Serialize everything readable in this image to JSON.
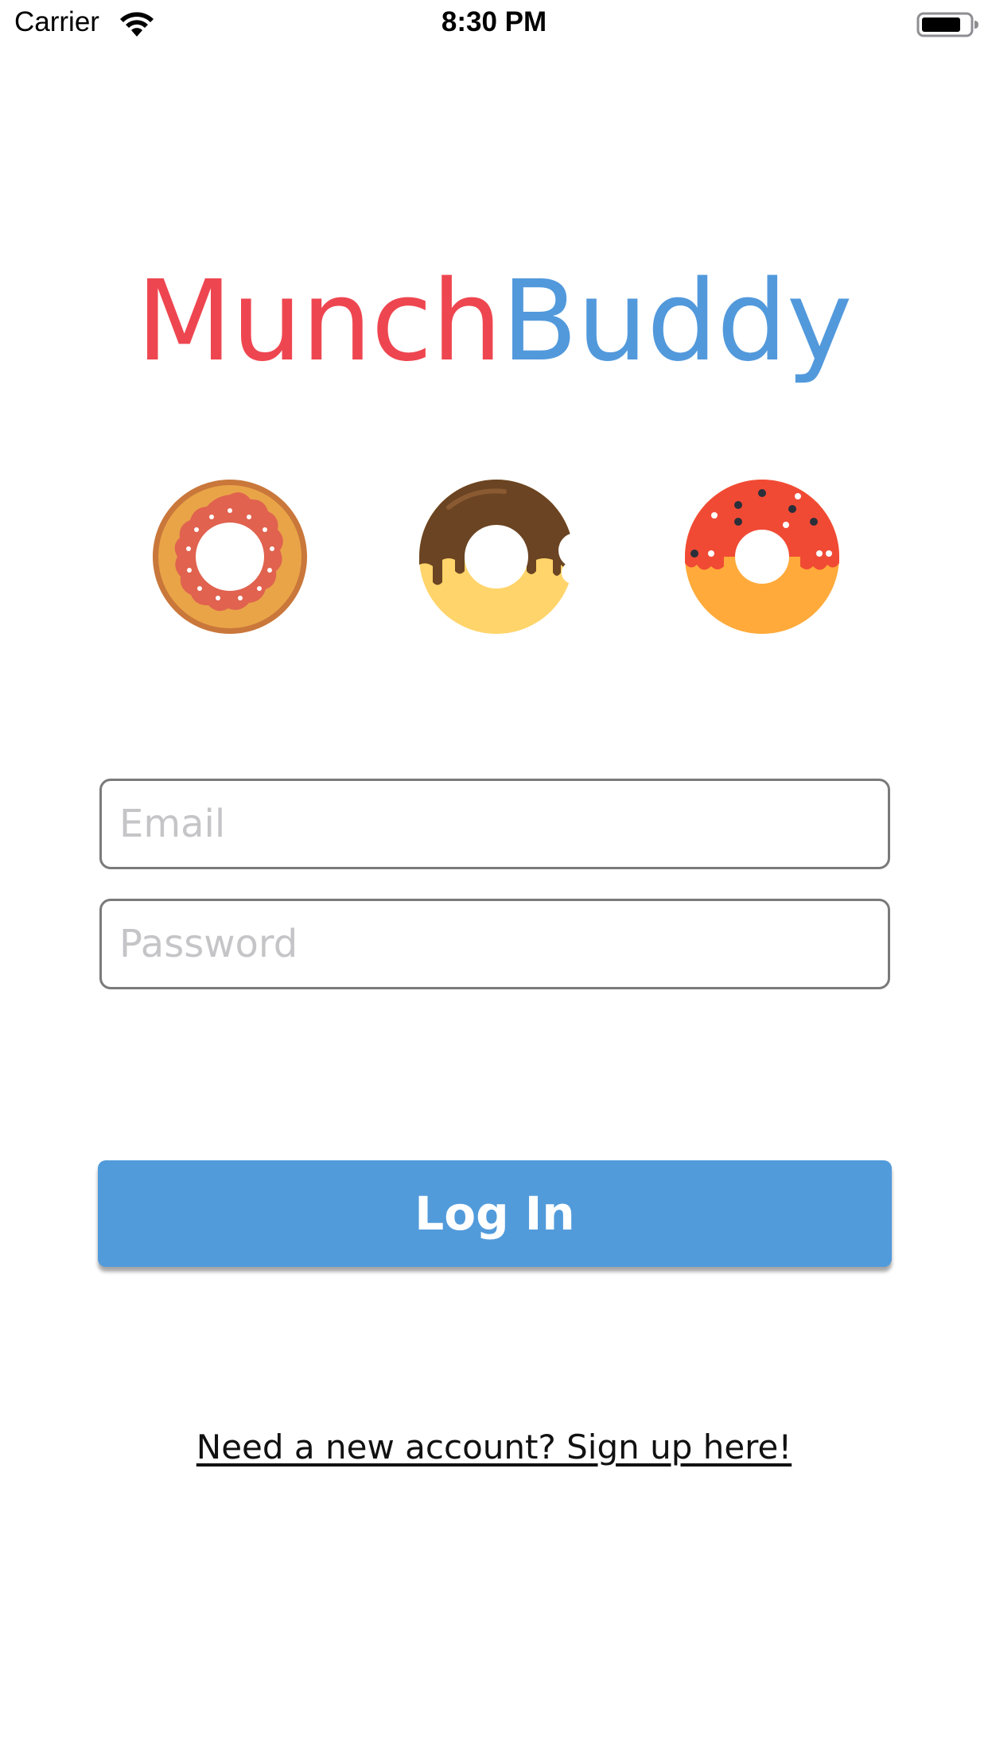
{
  "status_bar": {
    "carrier": "Carrier",
    "time": "8:30 PM",
    "wifi_icon": "wifi-icon",
    "battery_icon": "battery-icon"
  },
  "brand": {
    "part1": "Munch",
    "part2": "Buddy",
    "part1_color": "#ee4650",
    "part2_color": "#5299dc"
  },
  "donuts": [
    {
      "icon": "pink-frosted-donut-icon"
    },
    {
      "icon": "chocolate-bitten-donut-icon"
    },
    {
      "icon": "red-sprinkle-donut-icon"
    }
  ],
  "form": {
    "email_placeholder": "Email",
    "email_value": "",
    "password_placeholder": "Password",
    "password_value": ""
  },
  "login_button": {
    "label": "Log In",
    "color": "#529bdb"
  },
  "signup": {
    "label": "Need a new account? Sign up here!"
  }
}
